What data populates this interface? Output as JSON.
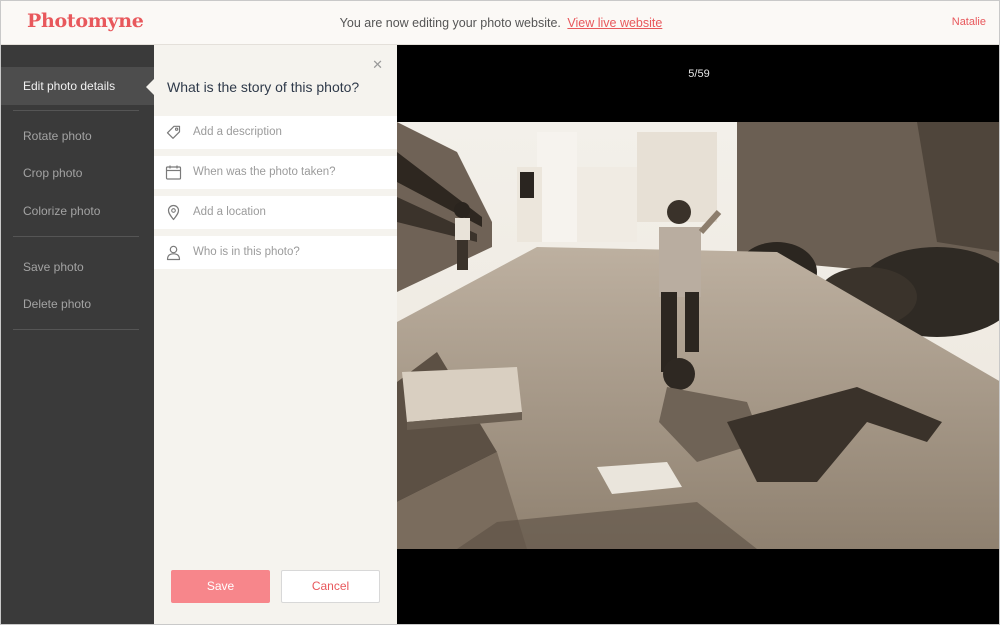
{
  "header": {
    "logo": "Photomyne",
    "banner_text": "You are now editing your photo website.",
    "banner_link": "View live website",
    "user_name": "Natalie"
  },
  "sidebar": {
    "items": [
      {
        "label": "Edit photo details",
        "active": true
      },
      {
        "label": "Rotate photo"
      },
      {
        "label": "Crop photo"
      },
      {
        "label": "Colorize photo"
      },
      {
        "label": "Save photo"
      },
      {
        "label": "Delete photo"
      }
    ]
  },
  "details_panel": {
    "title": "What is the story of this photo?",
    "close_icon": "close-icon",
    "fields": [
      {
        "icon": "tag-icon",
        "placeholder": "Add a description"
      },
      {
        "icon": "calendar-icon",
        "placeholder": "When was the photo taken?"
      },
      {
        "icon": "location-pin-icon",
        "placeholder": "Add a location"
      },
      {
        "icon": "person-icon",
        "placeholder": "Who is in this photo?"
      }
    ],
    "save_label": "Save",
    "cancel_label": "Cancel"
  },
  "viewer": {
    "counter": "5/59"
  },
  "colors": {
    "brand": "#e8585c",
    "save_button": "#f7868b",
    "sidebar_bg": "#3a3a3a",
    "panel_bg": "#f5f3ee",
    "viewer_bg": "#000000"
  }
}
